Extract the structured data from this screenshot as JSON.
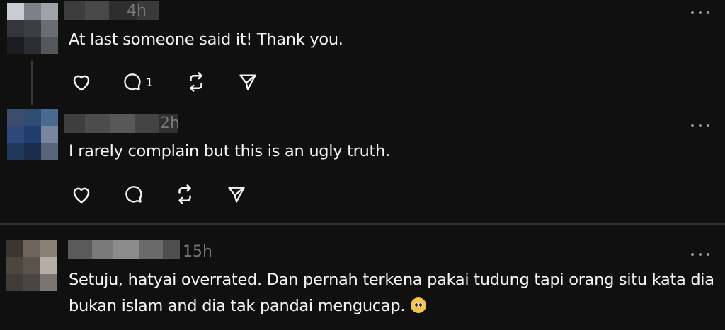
{
  "comments": [
    {
      "time": "4h",
      "text": "At last someone said it! Thank you.",
      "reply_count": "1",
      "avatar_colors": [
        "#c9ccd2",
        "#7d8088",
        "#9fa3a9",
        "#34363b",
        "#3c3e42",
        "#6a6d72",
        "#1c1d20",
        "#2c2d31",
        "#55575b"
      ],
      "name_colors": [
        "#3c3c3c",
        "#484848",
        "#2e2e2e",
        "#3a3a3a"
      ]
    },
    {
      "time": "2h",
      "text": "I rarely complain but this is an ugly truth.",
      "reply_count": "",
      "avatar_colors": [
        "#3b4d6b",
        "#2f4d73",
        "#4a6990",
        "#2b4a7a",
        "#1f3d6d",
        "#7886a0",
        "#22385a",
        "#1a2d4d",
        "#5a6478"
      ],
      "name_colors": [
        "#3e3e3e",
        "#4c4c4c",
        "#585858",
        "#444444",
        "#303030"
      ]
    },
    {
      "time": "15h",
      "text_lines": [
        "Setuju, hatyai overrated. Dan pernah terkena pakai tudung tapi orang situ kata dia",
        "bukan islam and dia tak pandai mengucap."
      ],
      "emoji": "pleading-face",
      "reply_count": "",
      "avatar_colors": [
        "#3a3530",
        "#6d655c",
        "#8a8175",
        "#4c4640",
        "#5a534c",
        "#b4aea6",
        "#3f3b37",
        "#4a4541",
        "#7a7570"
      ],
      "name_colors": [
        "#5a5a5a",
        "#7a7a7a",
        "#8c8c8c",
        "#6a6a6a",
        "#4e4e4e"
      ]
    }
  ],
  "icons": {
    "like": "heart-icon",
    "reply": "comment-icon",
    "repost": "repost-icon",
    "share": "send-icon",
    "more": "more-icon"
  },
  "colors": {
    "background": "#101010",
    "text": "#f3f5f7",
    "muted": "#777777",
    "divider": "#2e2e2e"
  }
}
